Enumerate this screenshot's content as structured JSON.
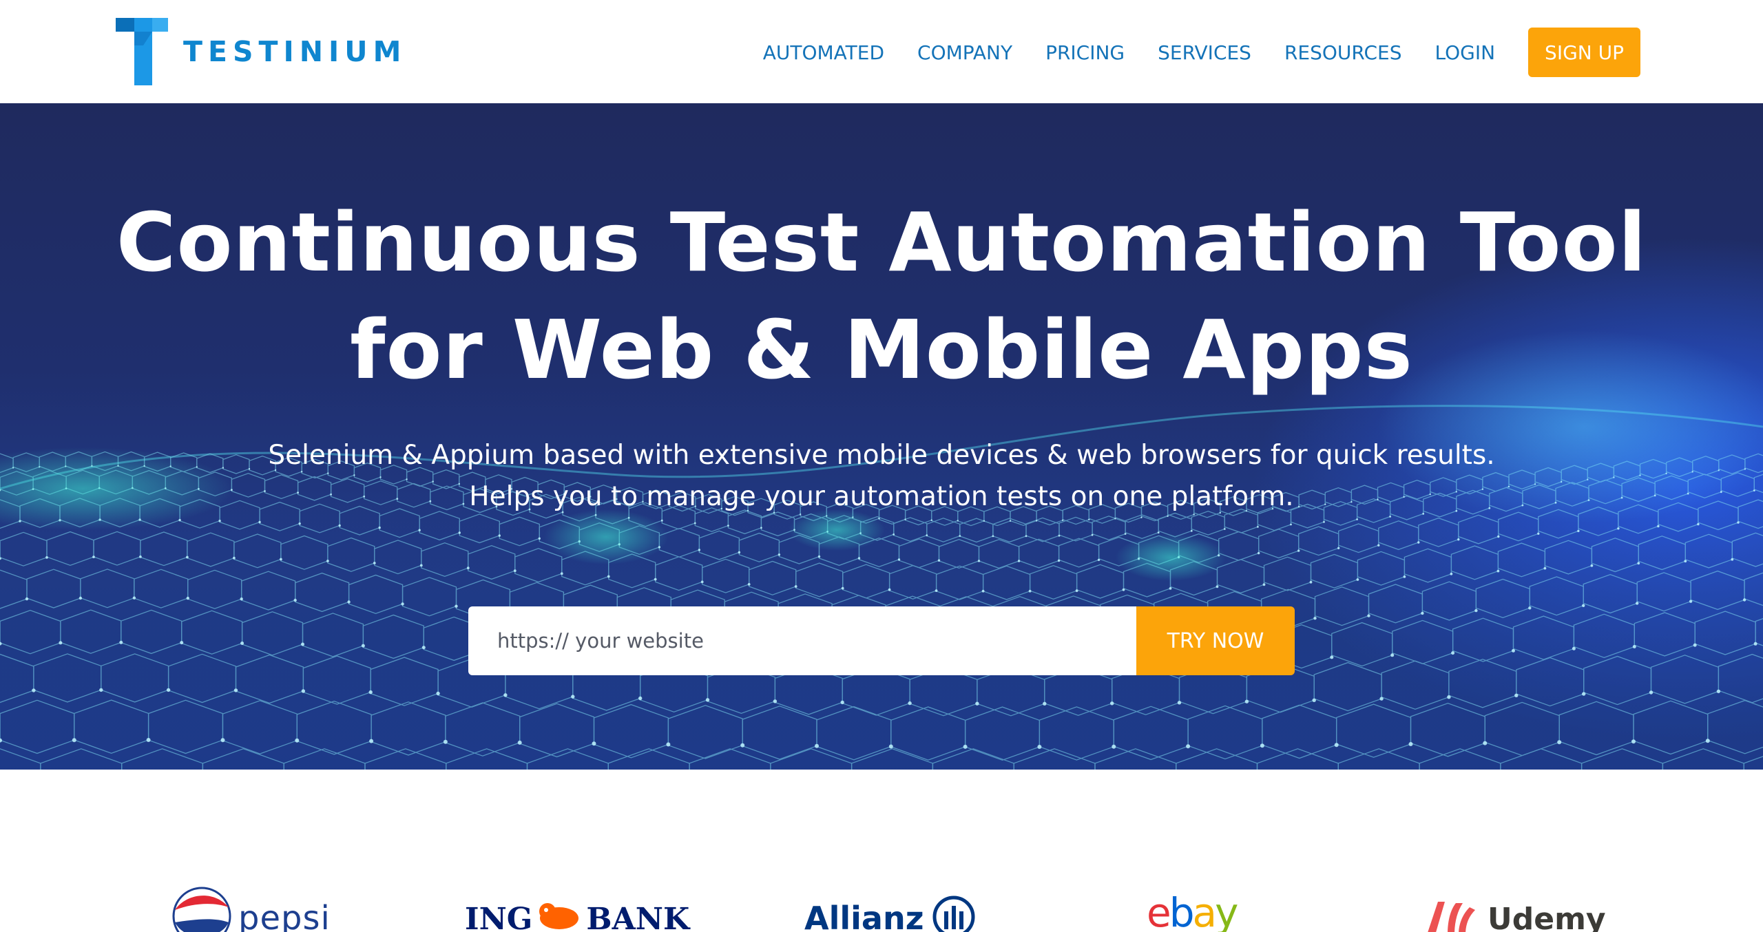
{
  "brand": {
    "name": "TESTINIUM",
    "color": "#0f86cf"
  },
  "nav": {
    "items": [
      "AUTOMATED",
      "COMPANY",
      "PRICING",
      "SERVICES",
      "RESOURCES",
      "LOGIN"
    ],
    "signup_label": "SIGN UP",
    "accent_color": "#fca40a"
  },
  "hero": {
    "title_line1": "Continuous Test Automation Tool",
    "title_line2": "for Web & Mobile Apps",
    "subtitle_line1": "Selenium & Appium based with extensive mobile devices & web browsers for quick results.",
    "subtitle_line2": "Helps you to manage your automation tests on one platform.",
    "input_placeholder": "https:// your website",
    "cta_label": "TRY NOW"
  },
  "clients": [
    {
      "name": "pepsi",
      "icon": "pepsi-globe-icon"
    },
    {
      "name": "ING",
      "name2": "BANK",
      "icon": "ing-lion-icon"
    },
    {
      "name": "Allianz",
      "icon": "allianz-eagle-icon"
    },
    {
      "name": "ebay",
      "colors": [
        "#e53238",
        "#0064d2",
        "#f5af02",
        "#86b817"
      ]
    },
    {
      "name": "Udemy",
      "icon": "udemy-mark-icon",
      "color": "#ec5252"
    }
  ]
}
